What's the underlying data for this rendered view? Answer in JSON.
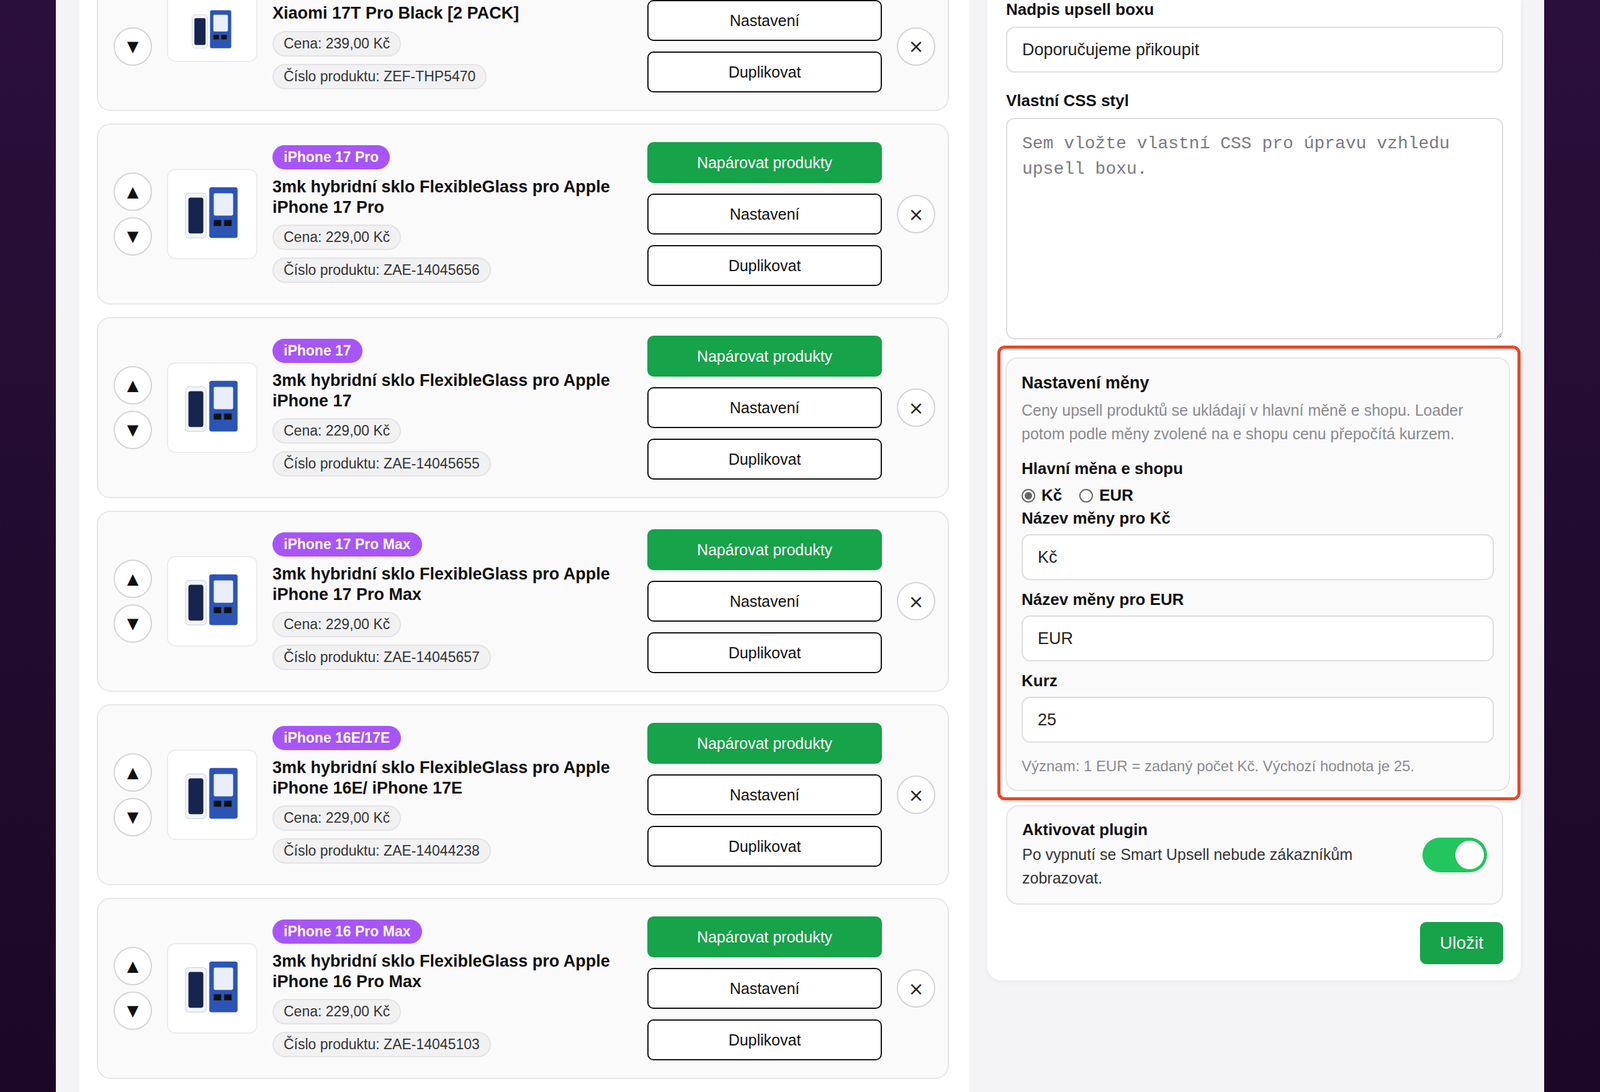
{
  "controls": {
    "up": "▲",
    "down": "▼",
    "remove": "×"
  },
  "products": [
    {
      "partial": true,
      "title": "Xiaomi 17T Pro Black [2 PACK]",
      "price": "Cena: 239,00 Kč",
      "code": "Číslo produktu: ZEF-THP5470",
      "buttons": [
        {
          "label": "Nastavení",
          "kind": "outline"
        },
        {
          "label": "Duplikovat",
          "kind": "outline"
        }
      ]
    },
    {
      "partial": false,
      "badge": "iPhone 17 Pro",
      "title": "3mk hybridní sklo FlexibleGlass pro Apple iPhone 17 Pro",
      "price": "Cena: 229,00 Kč",
      "code": "Číslo produktu: ZAE-14045656",
      "buttons": [
        {
          "label": "Napárovat produkty",
          "kind": "primary"
        },
        {
          "label": "Nastavení",
          "kind": "outline"
        },
        {
          "label": "Duplikovat",
          "kind": "outline"
        }
      ]
    },
    {
      "partial": false,
      "badge": "iPhone 17",
      "title": "3mk hybridní sklo FlexibleGlass pro Apple iPhone 17",
      "price": "Cena: 229,00 Kč",
      "code": "Číslo produktu: ZAE-14045655",
      "buttons": [
        {
          "label": "Napárovat produkty",
          "kind": "primary"
        },
        {
          "label": "Nastavení",
          "kind": "outline"
        },
        {
          "label": "Duplikovat",
          "kind": "outline"
        }
      ]
    },
    {
      "partial": false,
      "badge": "iPhone 17 Pro Max",
      "title": "3mk hybridní sklo FlexibleGlass pro Apple iPhone 17 Pro Max",
      "price": "Cena: 229,00 Kč",
      "code": "Číslo produktu: ZAE-14045657",
      "buttons": [
        {
          "label": "Napárovat produkty",
          "kind": "primary"
        },
        {
          "label": "Nastavení",
          "kind": "outline"
        },
        {
          "label": "Duplikovat",
          "kind": "outline"
        }
      ]
    },
    {
      "partial": false,
      "badge": "iPhone 16E/17E",
      "title": "3mk hybridní sklo FlexibleGlass pro Apple iPhone 16E/ iPhone 17E",
      "price": "Cena: 229,00 Kč",
      "code": "Číslo produktu: ZAE-14044238",
      "buttons": [
        {
          "label": "Napárovat produkty",
          "kind": "primary"
        },
        {
          "label": "Nastavení",
          "kind": "outline"
        },
        {
          "label": "Duplikovat",
          "kind": "outline"
        }
      ]
    },
    {
      "partial": false,
      "badge": "iPhone 16 Pro Max",
      "title": "3mk hybridní sklo FlexibleGlass pro Apple iPhone 16 Pro Max",
      "price": "Cena: 229,00 Kč",
      "code": "Číslo produktu: ZAE-14045103",
      "buttons": [
        {
          "label": "Napárovat produkty",
          "kind": "primary"
        },
        {
          "label": "Nastavení",
          "kind": "outline"
        },
        {
          "label": "Duplikovat",
          "kind": "outline"
        }
      ]
    }
  ],
  "settings": {
    "box_title": {
      "label": "Nadpis upsell boxu",
      "value": "Doporučujeme přikoupit"
    },
    "css": {
      "label": "Vlastní CSS styl",
      "placeholder": "Sem vložte vlastní CSS pro úpravu vzhledu upsell boxu."
    },
    "currency": {
      "highlighted": true,
      "title": "Nastavení měny",
      "description": "Ceny upsell produktů se ukládají v hlavní měně e shopu. Loader potom podle měny zvolené na e shopu cenu přepočítá kurzem.",
      "main_label": "Hlavní měna e shopu",
      "options": [
        {
          "label": "Kč",
          "selected": true
        },
        {
          "label": "EUR",
          "selected": false
        }
      ],
      "fields": [
        {
          "label": "Název měny pro Kč",
          "value": "Kč"
        },
        {
          "label": "Název měny pro EUR",
          "value": "EUR"
        },
        {
          "label": "Kurz",
          "value": "25"
        }
      ],
      "hint": "Význam: 1 EUR = zadaný počet Kč. Výchozí hodnota je 25."
    },
    "plugin": {
      "title": "Aktivovat plugin",
      "description": "Po vypnutí se Smart Upsell nebude zákazníkům zobrazovat.",
      "on": true
    },
    "save": "Uložit"
  }
}
